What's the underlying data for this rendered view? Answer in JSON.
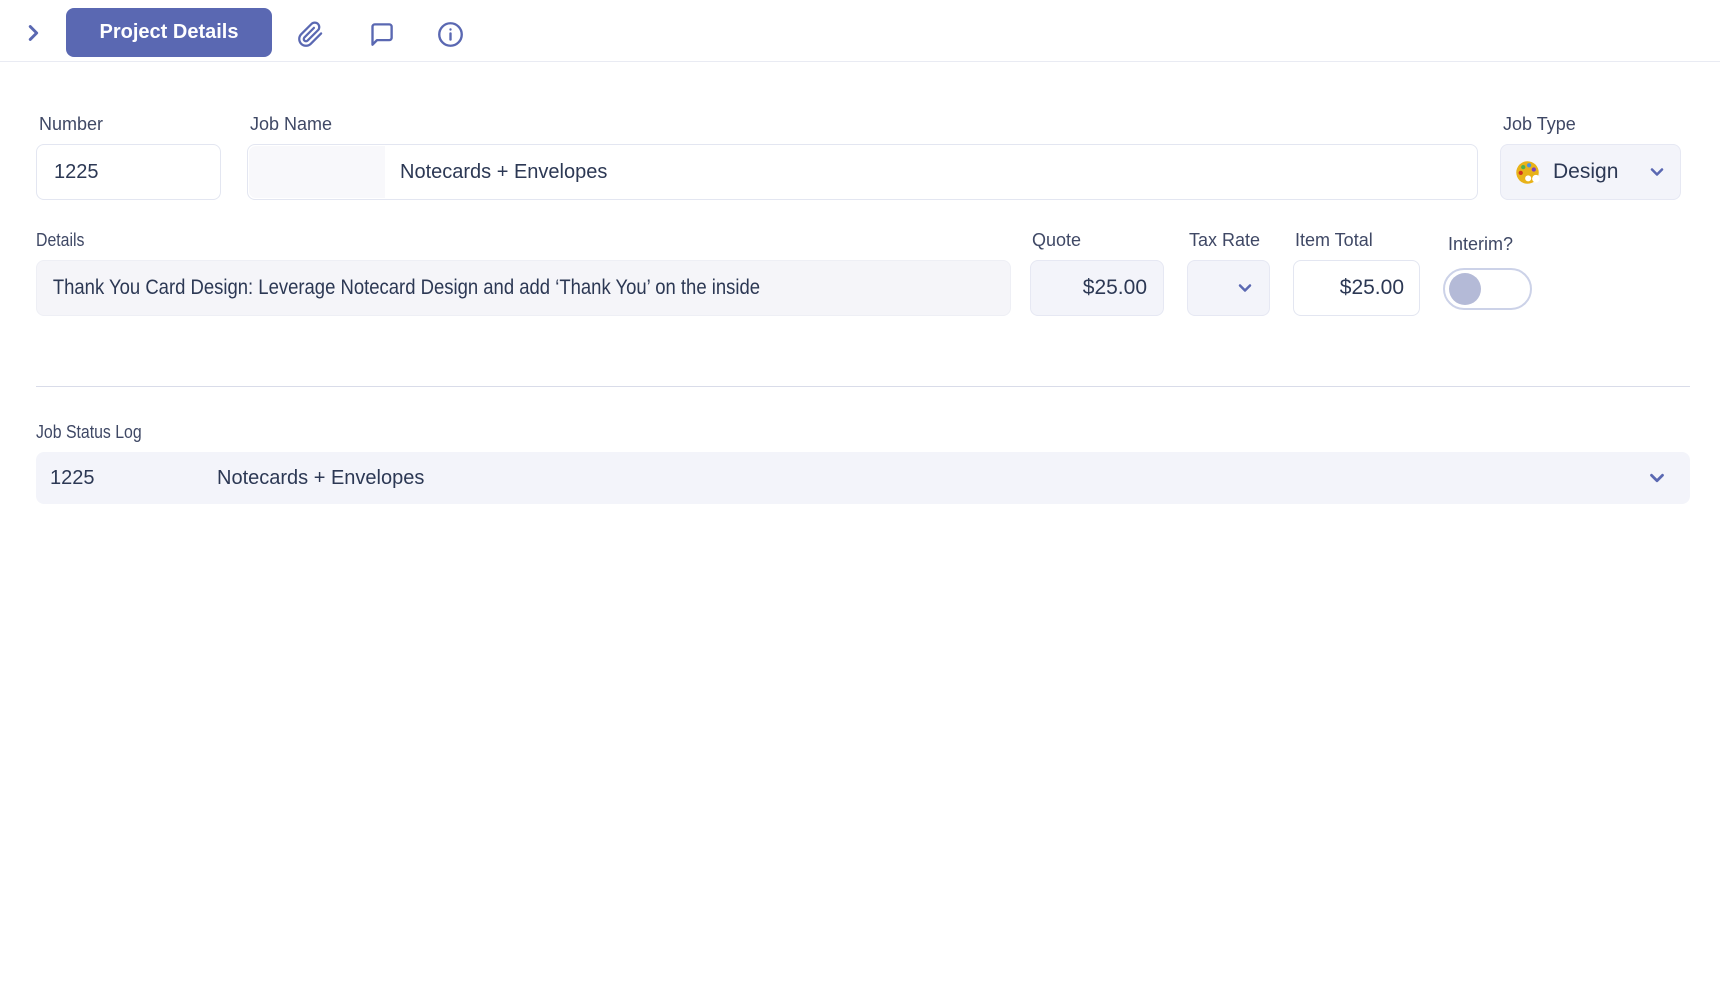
{
  "toolbar": {
    "project_details_label": "Project Details"
  },
  "form": {
    "number": {
      "label": "Number",
      "value": "1225"
    },
    "job_name": {
      "label": "Job Name",
      "value": "Notecards + Envelopes"
    },
    "job_type": {
      "label": "Job Type",
      "value": "Design"
    },
    "details": {
      "label": "Details",
      "value": "Thank You Card Design: Leverage Notecard Design and add ‘Thank You’ on the inside"
    },
    "quote": {
      "label": "Quote",
      "value": "$25.00"
    },
    "tax_rate": {
      "label": "Tax Rate",
      "value": ""
    },
    "item_total": {
      "label": "Item Total",
      "value": "$25.00"
    },
    "interim": {
      "label": "Interim?",
      "state": "off"
    }
  },
  "job_status_log": {
    "label": "Job Status Log",
    "row": {
      "number": "1225",
      "name": "Notecards + Envelopes"
    }
  },
  "colors": {
    "accent": "#5a68b2",
    "label_text": "#3f4865",
    "value_text": "#2c3854",
    "field_border": "#e3e6f1",
    "field_fill": "#f3f4fa",
    "toggle_knob": "#b4bad7",
    "divider": "#d9dce9"
  }
}
